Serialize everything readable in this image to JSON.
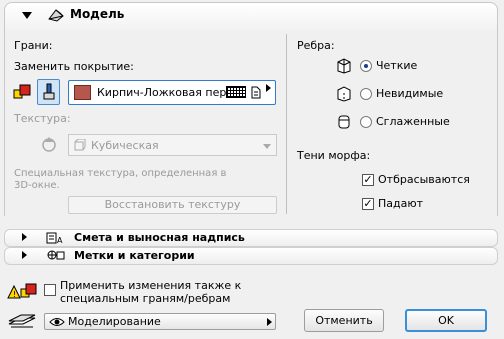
{
  "panel": {
    "title": "Модель"
  },
  "surfaces": {
    "label": "Грани:",
    "override_label": "Заменить покрытие:",
    "surface_name": "Кирпич-Ложковая пер...",
    "swatch_color": "#b5574d"
  },
  "texture": {
    "label": "Текстура:",
    "value": "Кубическая",
    "note_line1": "Специальная текстура, определенная в",
    "note_line2": "3D-окне.",
    "reset_label": "Восстановить текстуру"
  },
  "edges": {
    "label": "Ребра:",
    "options": [
      {
        "label": "Четкие",
        "selected": true
      },
      {
        "label": "Невидимые",
        "selected": false
      },
      {
        "label": "Сглаженные",
        "selected": false
      }
    ]
  },
  "shadows": {
    "label": "Тени морфа:",
    "options": [
      {
        "label": "Отбрасываются",
        "checked": true
      },
      {
        "label": "Падают",
        "checked": true
      }
    ]
  },
  "sections": [
    {
      "label": "Смета и выносная надпись"
    },
    {
      "label": "Метки и категории"
    }
  ],
  "footer": {
    "apply_line1": "Применить изменения также к",
    "apply_line2": "специальным граням/ребрам",
    "view_label": "Моделирование",
    "cancel_label": "Отменить",
    "ok_label": "OK",
    "accent_color": "#3b8fd8"
  }
}
